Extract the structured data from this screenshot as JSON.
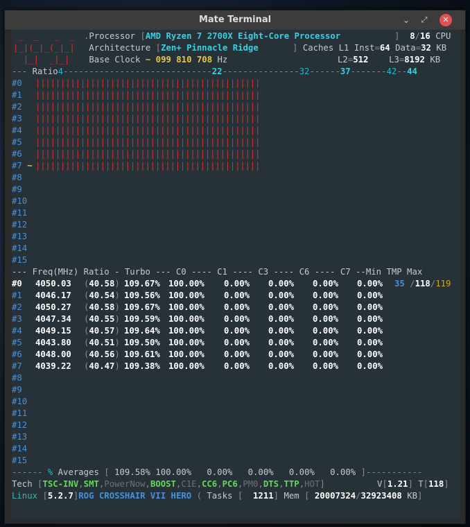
{
  "window": {
    "title": "Mate Terminal"
  },
  "header": {
    "logo": [
      " _  _   _  _",
      "|_|(_|_(_|_|",
      "  |_|  _|_|"
    ],
    "processor_label": "Processor",
    "processor_value": "AMD Ryzen 7 2700X Eight-Core Processor",
    "cpu_online": "8",
    "cpu_total": "16",
    "cpu_word": "CPU",
    "arch_label": "Architecture",
    "arch_value": "Zen+ Pinnacle Ridge",
    "caches_label": "Caches L1 Inst",
    "l1_inst": "64",
    "data_label": "Data",
    "l1_data": "32",
    "kb1": "KB",
    "base_clock_label": "Base Clock",
    "base_clock_value": "~ 099 810 708",
    "hz": "Hz",
    "l2_label": "L2",
    "l2_value": "512",
    "l3_label": "L3",
    "l3_value": "8192",
    "kb2": "KB"
  },
  "ratio_header": {
    "label": "Ratio",
    "mark_4": "4",
    "mark_22": "22",
    "mark_32": "32",
    "mark_37": "37",
    "mark_42": "42",
    "mark_44": "44"
  },
  "ratio_rows": [
    {
      "id": "#0",
      "bar_count": 45,
      "marker": ""
    },
    {
      "id": "#1",
      "bar_count": 45,
      "marker": ""
    },
    {
      "id": "#2",
      "bar_count": 45,
      "marker": ""
    },
    {
      "id": "#3",
      "bar_count": 45,
      "marker": ""
    },
    {
      "id": "#4",
      "bar_count": 45,
      "marker": ""
    },
    {
      "id": "#5",
      "bar_count": 45,
      "marker": ""
    },
    {
      "id": "#6",
      "bar_count": 45,
      "marker": ""
    },
    {
      "id": "#7",
      "bar_count": 45,
      "marker": "~"
    },
    {
      "id": "#8",
      "bar_count": 0,
      "marker": ""
    },
    {
      "id": "#9",
      "bar_count": 0,
      "marker": ""
    },
    {
      "id": "#10",
      "bar_count": 0,
      "marker": ""
    },
    {
      "id": "#11",
      "bar_count": 0,
      "marker": ""
    },
    {
      "id": "#12",
      "bar_count": 0,
      "marker": ""
    },
    {
      "id": "#13",
      "bar_count": 0,
      "marker": ""
    },
    {
      "id": "#14",
      "bar_count": 0,
      "marker": ""
    },
    {
      "id": "#15",
      "bar_count": 0,
      "marker": ""
    }
  ],
  "freq_header": "--- Freq(MHz) Ratio - Turbo --- C0 ---- C1 ---- C3 ---- C6 ---- C7 --Min TMP Max",
  "freq_rows": [
    {
      "id": "#0",
      "freq": "4050.03",
      "ratio": "40.58",
      "turbo": "109.67%",
      "c0": "100.00%",
      "c1": "0.00%",
      "c3": "0.00%",
      "c6": "0.00%",
      "c7": "0.00%",
      "tmin": "35",
      "tcur": "118",
      "tmax": "119"
    },
    {
      "id": "#1",
      "freq": "4046.17",
      "ratio": "40.54",
      "turbo": "109.56%",
      "c0": "100.00%",
      "c1": "0.00%",
      "c3": "0.00%",
      "c6": "0.00%",
      "c7": "0.00%"
    },
    {
      "id": "#2",
      "freq": "4050.27",
      "ratio": "40.58",
      "turbo": "109.67%",
      "c0": "100.00%",
      "c1": "0.00%",
      "c3": "0.00%",
      "c6": "0.00%",
      "c7": "0.00%"
    },
    {
      "id": "#3",
      "freq": "4047.34",
      "ratio": "40.55",
      "turbo": "109.59%",
      "c0": "100.00%",
      "c1": "0.00%",
      "c3": "0.00%",
      "c6": "0.00%",
      "c7": "0.00%"
    },
    {
      "id": "#4",
      "freq": "4049.15",
      "ratio": "40.57",
      "turbo": "109.64%",
      "c0": "100.00%",
      "c1": "0.00%",
      "c3": "0.00%",
      "c6": "0.00%",
      "c7": "0.00%"
    },
    {
      "id": "#5",
      "freq": "4043.80",
      "ratio": "40.51",
      "turbo": "109.50%",
      "c0": "100.00%",
      "c1": "0.00%",
      "c3": "0.00%",
      "c6": "0.00%",
      "c7": "0.00%"
    },
    {
      "id": "#6",
      "freq": "4048.00",
      "ratio": "40.56",
      "turbo": "109.61%",
      "c0": "100.00%",
      "c1": "0.00%",
      "c3": "0.00%",
      "c6": "0.00%",
      "c7": "0.00%"
    },
    {
      "id": "#7",
      "freq": "4039.22",
      "ratio": "40.47",
      "turbo": "109.38%",
      "c0": "100.00%",
      "c1": "0.00%",
      "c3": "0.00%",
      "c6": "0.00%",
      "c7": "0.00%"
    }
  ],
  "empty_freq_rows": [
    "#8",
    "#9",
    "#10",
    "#11",
    "#12",
    "#13",
    "#14",
    "#15"
  ],
  "averages": {
    "label": "Averages",
    "pct": "%",
    "turbo": "109.58%",
    "c0": "100.00%",
    "c1": "0.00%",
    "c3": "0.00%",
    "c6": "0.00%",
    "c7": "0.00%"
  },
  "tech": {
    "label": "Tech",
    "items": [
      {
        "name": "TSC-INV",
        "enabled": true
      },
      {
        "name": "SMT",
        "enabled": true
      },
      {
        "name": "PowerNow",
        "enabled": false
      },
      {
        "name": "BOOST",
        "enabled": true
      },
      {
        "name": "C1E",
        "enabled": false
      },
      {
        "name": "CC6",
        "enabled": true
      },
      {
        "name": "PC6",
        "enabled": true
      },
      {
        "name": "PM0",
        "enabled": false
      },
      {
        "name": "DTS",
        "enabled": true
      },
      {
        "name": "TTP",
        "enabled": true
      },
      {
        "name": "HOT",
        "enabled": false
      }
    ],
    "voltage_label": "V",
    "voltage": "1.21",
    "temp_label": "T",
    "temp": "118"
  },
  "footer": {
    "os": "Linux",
    "kernel": "5.2.7",
    "board": "ROG CROSSHAIR VII HERO",
    "tasks_label": "Tasks",
    "tasks": "1211",
    "mem_label": "Mem",
    "mem_used": "20007324",
    "mem_total": "32923408",
    "mem_unit": "KB"
  },
  "colors": {
    "terminal_bg": "#263238",
    "bar_red": "#d03030",
    "cyan": "#39d0e0",
    "green": "#62d958",
    "yellow": "#e6c84a",
    "blue": "#4a90d9"
  }
}
